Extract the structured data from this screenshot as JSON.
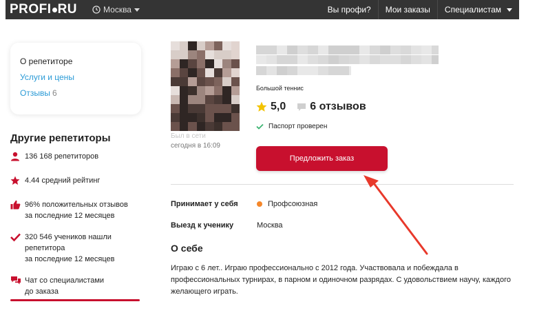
{
  "header": {
    "logo": "PROFI",
    "logo_suffix": "RU",
    "city": "Москва",
    "nav": [
      "Вы профи?",
      "Мои заказы",
      "Специалистам"
    ]
  },
  "sidebar": {
    "items": [
      {
        "label": "О репетиторе",
        "count": ""
      },
      {
        "label": "Услуги и цены",
        "count": ""
      },
      {
        "label": "Отзывы",
        "count": "6"
      }
    ]
  },
  "others": {
    "title": "Другие репетиторы",
    "stats": [
      {
        "icon": "person-icon",
        "lines": [
          "136 168 репетиторов"
        ]
      },
      {
        "icon": "star-icon",
        "lines": [
          "4.44 средний рейтинг"
        ]
      },
      {
        "icon": "thumbs-up-icon",
        "lines": [
          "96% положительных отзывов",
          "за последние 12 месяцев"
        ]
      },
      {
        "icon": "check-icon",
        "lines": [
          "320 546 учеников нашли",
          "репетитора",
          "за последние 12 месяцев"
        ]
      },
      {
        "icon": "chat-icon",
        "lines": [
          "Чат со специалистами",
          "до заказа"
        ]
      }
    ]
  },
  "profile": {
    "visit_line1": "Был в сети",
    "visit_line2": "сегодня в 16:09",
    "subject": "Большой теннис",
    "rating": "5,0",
    "reviews": "6 отзывов",
    "passport": "Паспорт проверен",
    "order_button": "Предложить заказ"
  },
  "details": {
    "rows": [
      {
        "label": "Принимает у себя",
        "value": "Профсоюзная"
      },
      {
        "label": "Выезд к ученику",
        "value": "Москва"
      }
    ],
    "about_title": "О себе",
    "about_text": "Играю с 6 лет.. Играю профессионально с 2012 года. Участвовала и побеждала в профессиональных турнирах, в парном и одиночном разрядах. С удовольствием научу, каждого желающего играть."
  },
  "colors": {
    "accent": "#c8102e",
    "link": "#2a9ad6",
    "header_bg": "#343434",
    "star": "#f3c300",
    "metro": "#f5872a",
    "check": "#3cb371",
    "annotation_arrow": "#e8392b"
  }
}
